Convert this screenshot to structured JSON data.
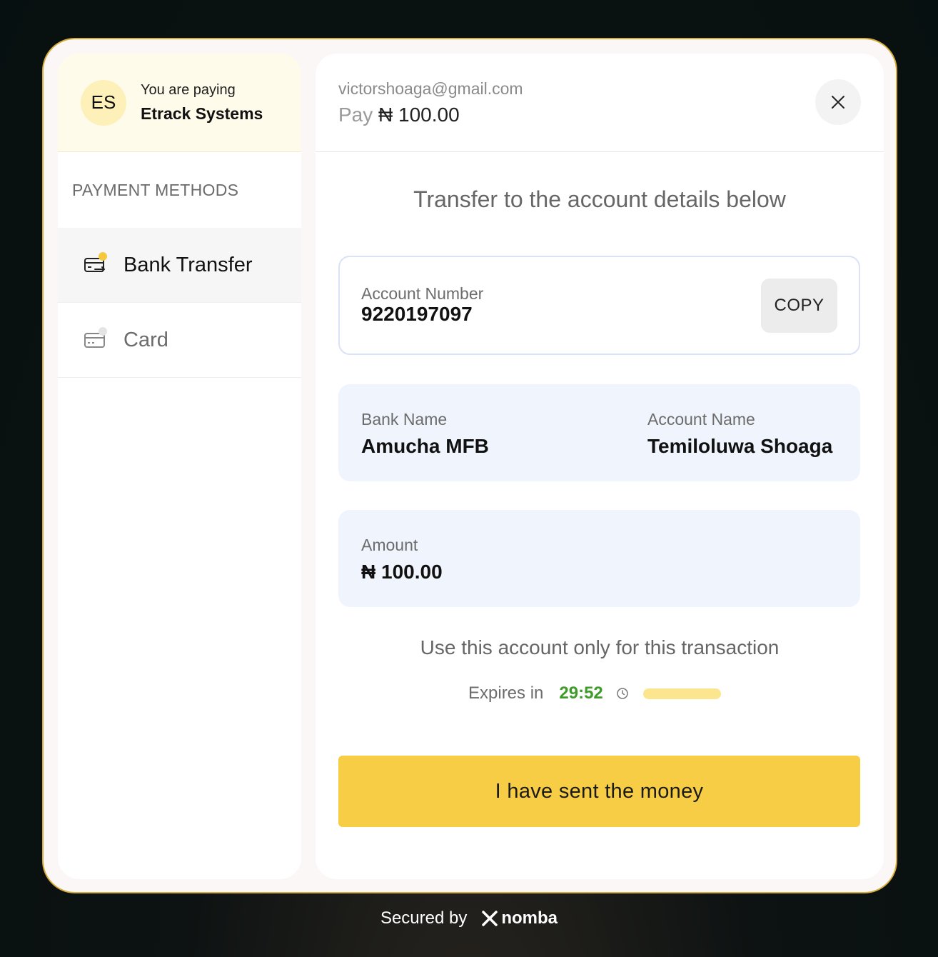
{
  "payee": {
    "initials": "ES",
    "label": "You are paying",
    "name": "Etrack Systems"
  },
  "payment_methods": {
    "title": "PAYMENT METHODS",
    "items": [
      {
        "label": "Bank Transfer",
        "icon": "bank-transfer-icon",
        "active": true
      },
      {
        "label": "Card",
        "icon": "card-icon",
        "active": false
      }
    ]
  },
  "header": {
    "email": "victorshoaga@gmail.com",
    "pay_word": "Pay",
    "pay_amount": "₦ 100.00"
  },
  "instruction": "Transfer to the account details below",
  "account": {
    "number_label": "Account Number",
    "number": "9220197097",
    "copy_label": "COPY",
    "bank_label": "Bank Name",
    "bank_name": "Amucha MFB",
    "name_label": "Account Name",
    "name": "Temiloluwa Shoaga"
  },
  "amount": {
    "label": "Amount",
    "value": "₦ 100.00"
  },
  "note": "Use this account only for this transaction",
  "expiry": {
    "label": "Expires in",
    "time": "29:52",
    "progress": 1.0
  },
  "sent_button": "I have sent the money",
  "footer": {
    "secured_by": "Secured by",
    "brand": "nomba"
  },
  "colors": {
    "accent": "#f6cd45",
    "timer": "#3e9b2a",
    "border": "#d6ad3c"
  }
}
